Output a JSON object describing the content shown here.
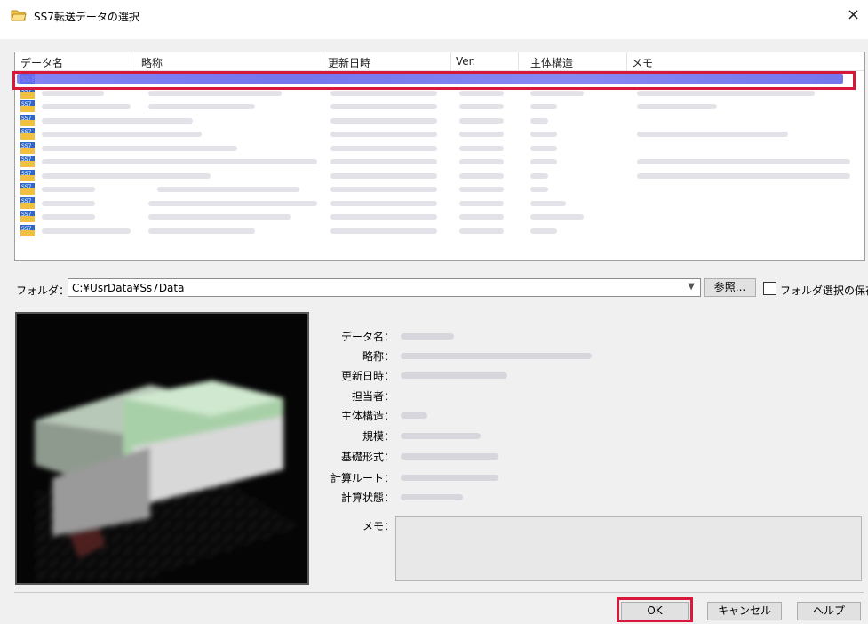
{
  "window": {
    "title": "SS7転送データの選択",
    "close_label": "×"
  },
  "list": {
    "columns": [
      "データ名",
      "略称",
      "更新日時",
      "Ver.",
      "主体構造",
      "メモ"
    ],
    "row_icon_text": "SS7"
  },
  "folder": {
    "label": "フォルダ：",
    "value": "C:¥UsrData¥Ss7Data",
    "browse_label": "参照...",
    "save_checkbox_label": "フォルダ選択の保存"
  },
  "properties": {
    "data_name": "データ名：",
    "abbr": "略称：",
    "updated": "更新日時：",
    "person": "担当者：",
    "structure": "主体構造：",
    "scale": "規模：",
    "foundation": "基礎形式：",
    "route": "計算ルート：",
    "calc_state": "計算状態：",
    "memo": "メモ："
  },
  "buttons": {
    "ok": "OK",
    "cancel": "キャンセル",
    "help": "ヘルプ"
  },
  "colors": {
    "highlight": "#d7183a",
    "selection": "#5b5de8"
  }
}
